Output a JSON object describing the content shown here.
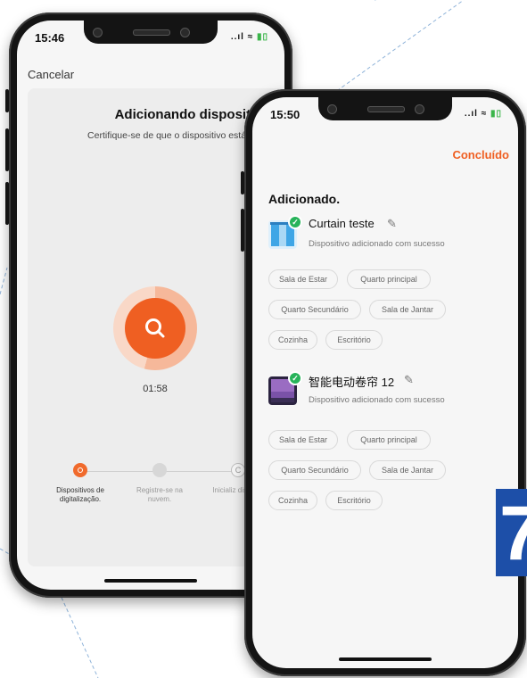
{
  "phone_left": {
    "status": {
      "time": "15:46",
      "signal": "..ıl ≈",
      "battery": "▮▯"
    },
    "cancel_label": "Cancelar",
    "title": "Adicionando dispositivo ...",
    "subtitle": "Certifique-se de que o dispositivo está ligado.",
    "timer": "01:58",
    "steps": [
      {
        "label": "Dispositivos de digitalização.",
        "state": "active"
      },
      {
        "label": "Registre-se na nuvem.",
        "state": "pending"
      },
      {
        "label": "Inicializ dispositi",
        "state": "pending"
      }
    ],
    "colors": {
      "accent": "#ef5f22"
    }
  },
  "phone_right": {
    "status": {
      "time": "15:50",
      "signal": "..ıl ≈",
      "battery": "▮▯"
    },
    "done_label": "Concluído",
    "heading": "Adicionado.",
    "devices": [
      {
        "name": "Curtain teste",
        "status": "Dispositivo adicionado com sucesso",
        "icon": "curtain-icon",
        "rooms": [
          "Sala de Estar",
          "Quarto principal",
          "Quarto Secundário",
          "Sala de Jantar",
          "Cozinha",
          "Escritório"
        ]
      },
      {
        "name": "智能电动卷帘 12",
        "status": "Dispositivo adicionado com sucesso",
        "icon": "roller-blind-icon",
        "rooms": [
          "Sala de Estar",
          "Quarto principal",
          "Quarto Secundário",
          "Sala de Jantar",
          "Cozinha",
          "Escritório"
        ]
      }
    ],
    "colors": {
      "accent": "#ef5f22",
      "success": "#27b35a"
    }
  },
  "corner_badge": "7"
}
